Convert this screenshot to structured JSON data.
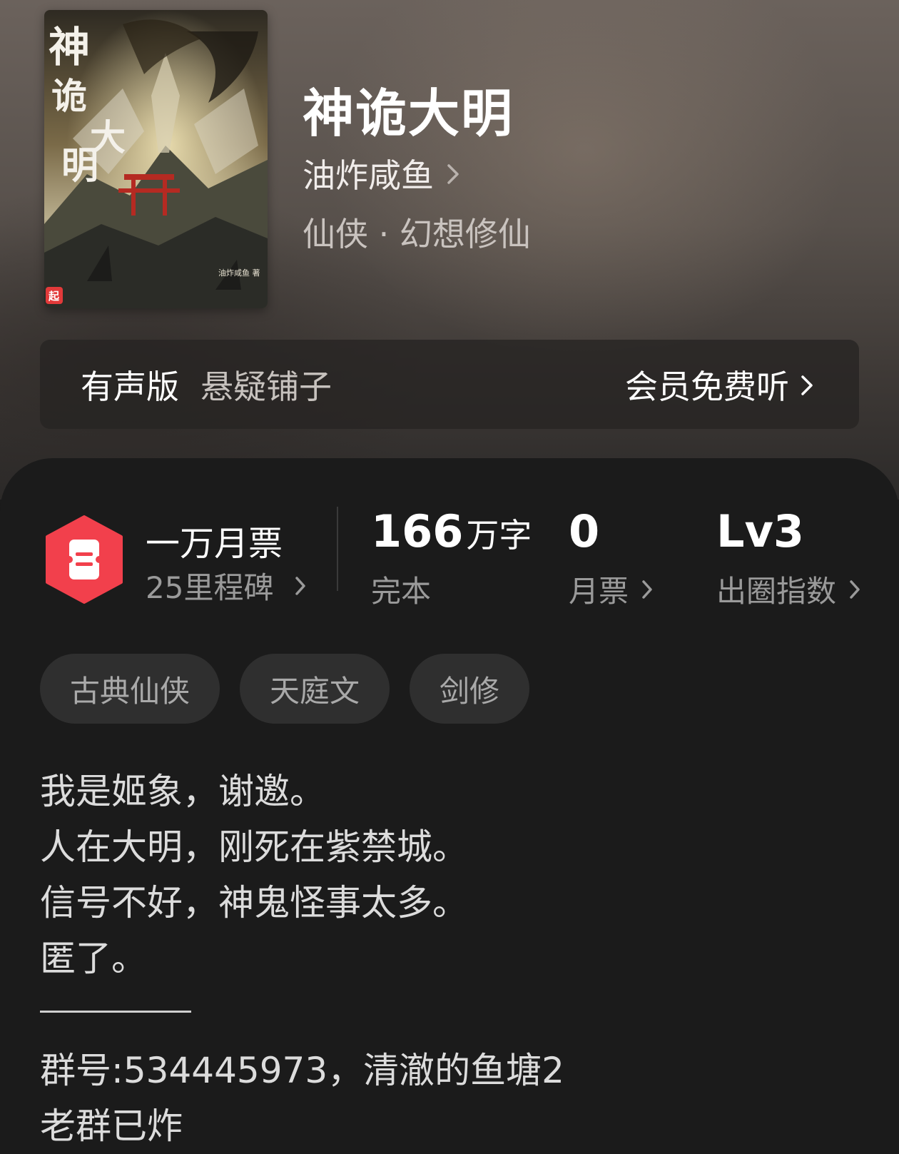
{
  "book": {
    "title": "神诡大明",
    "author": "油炸咸鱼",
    "genre": "仙侠 · 幻想修仙",
    "cover": {
      "title_text": "神诡大明",
      "badge": "起",
      "author_small": "油炸咸鱼 著"
    }
  },
  "audio": {
    "label": "有声版",
    "name": "悬疑铺子",
    "action": "会员免费听"
  },
  "stats": {
    "milestone": {
      "title": "一万月票",
      "sub": "25里程碑",
      "icon": "ticket-icon",
      "accent": "#f2404c"
    },
    "words": {
      "value": "166",
      "unit": "万字",
      "label": "完本"
    },
    "tickets": {
      "value": "0",
      "label": "月票"
    },
    "index": {
      "value": "Lv3",
      "label": "出圈指数"
    }
  },
  "tags": [
    "古典仙侠",
    "天庭文",
    "剑修"
  ],
  "intro": {
    "lines": [
      "我是姬象，谢邀。",
      "人在大明，刚死在紫禁城。",
      "信号不好，神鬼怪事太多。",
      "匿了。"
    ],
    "group": "群号:534445973，清澈的鱼塘2",
    "old_group": "老群已炸"
  },
  "colors": {
    "background": "#1b1b1b",
    "tag_bg": "#2f2f2f",
    "accent": "#f2404c"
  }
}
